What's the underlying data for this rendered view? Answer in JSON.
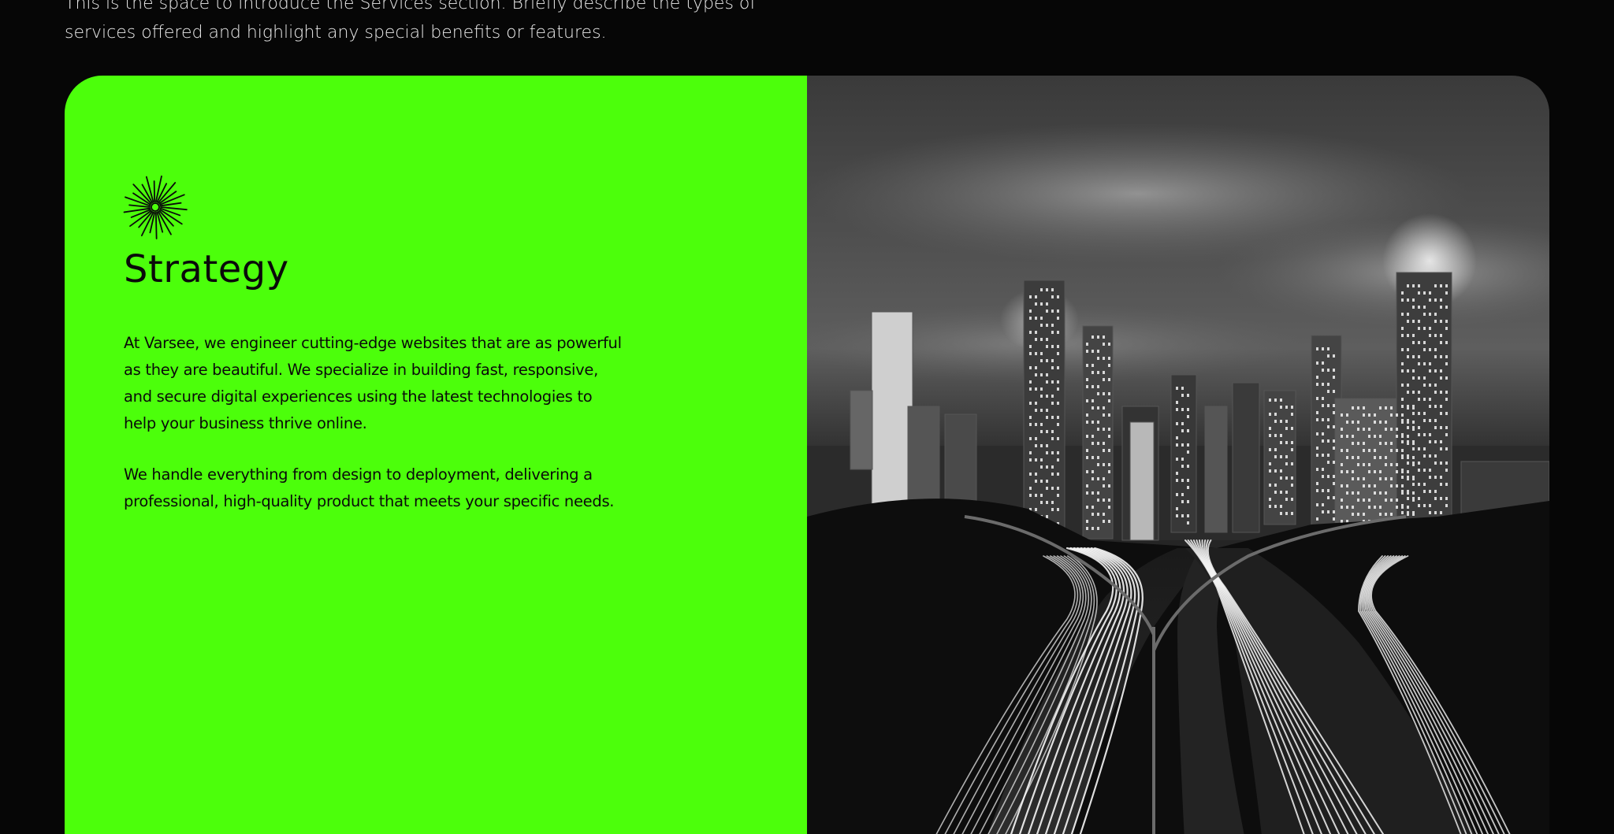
{
  "intro": {
    "line_1": "This is the space to introduce the Services section. Briefly describe the types of",
    "line_2": "services offered and highlight any special benefits or features."
  },
  "service": {
    "icon": "starburst-icon",
    "title": "Strategy",
    "paragraph_1": "At Varsee, we engineer cutting-edge websites that are as powerful as they are beautiful. We specialize in building fast, responsive, and secure digital experiences using the latest technologies to help your business thrive online.",
    "paragraph_2": "We handle everything from design to deployment, delivering a professional, high-quality product that meets your specific needs."
  },
  "colors": {
    "page_background": "#060606",
    "accent_green": "#4cff0b",
    "text_dark": "#0a0a0a",
    "text_light": "#e9e9e9"
  },
  "image": {
    "subject": "city-skyline-night-highway-photo"
  }
}
